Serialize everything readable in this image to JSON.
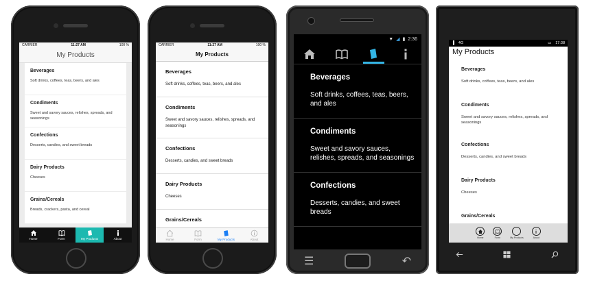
{
  "ios": {
    "carrier": "CARRIER",
    "time": "11:27 AM",
    "battery": "100 %"
  },
  "page_title": "My Products",
  "categories": [
    {
      "title": "Beverages",
      "desc": "Soft drinks, coffees, teas, beers, and ales"
    },
    {
      "title": "Condiments",
      "desc": "Sweet and savory sauces, relishes, spreads, and seasonings"
    },
    {
      "title": "Confections",
      "desc": "Desserts, candies, and sweet breads"
    },
    {
      "title": "Dairy Products",
      "desc": "Cheeses"
    },
    {
      "title": "Grains/Cereals",
      "desc": "Breads, crackers, pasta, and cereal"
    }
  ],
  "tabs_ios1": [
    "Home",
    "Form",
    "My Products",
    "About"
  ],
  "tabs_ios2": [
    "Home",
    "Form",
    "My Products",
    "About"
  ],
  "android": {
    "time": "2:36"
  },
  "winphone": {
    "network": "4G",
    "time": "17:38"
  },
  "wp_appbar": [
    "Home",
    "Form",
    "My Products",
    "About"
  ]
}
